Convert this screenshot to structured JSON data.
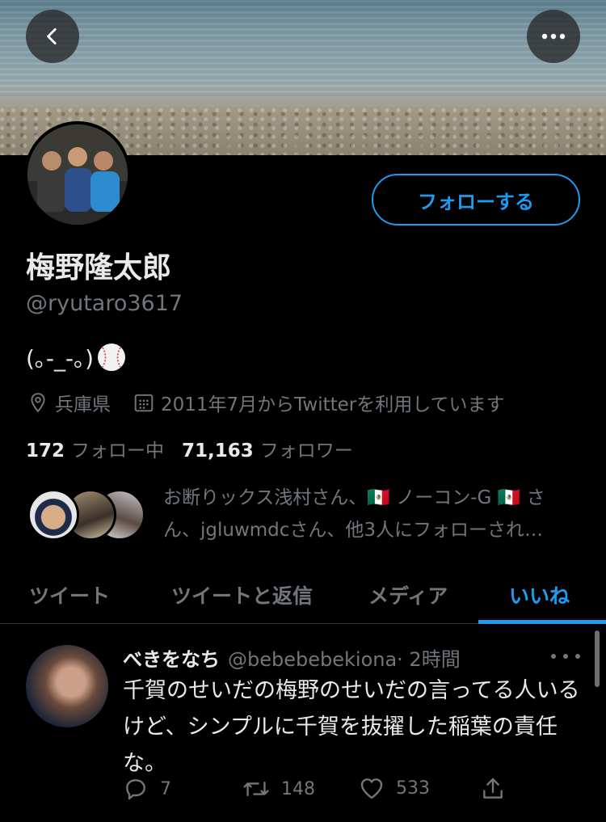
{
  "profile": {
    "name": "梅野隆太郎",
    "handle": "@ryutaro3617",
    "bio": "(｡-_-｡)",
    "location": "兵庫県",
    "joined": "2011年7月からTwitterを利用しています",
    "following_count": "172",
    "following_label": "フォロー中",
    "followers_count": "71,163",
    "followers_label": "フォロワー",
    "follow_button": "フォローする",
    "followed_by_line1": "お断りックス浅村さん、🇲🇽 ノーコン-G 🇲🇽 さ",
    "followed_by_line2": "ん、jgluwmdcさん、他3人にフォローされ…"
  },
  "tabs": [
    {
      "label": "ツイート",
      "active": false
    },
    {
      "label": "ツイートと返信",
      "active": false
    },
    {
      "label": "メディア",
      "active": false
    },
    {
      "label": "いいね",
      "active": true
    }
  ],
  "tweet": {
    "name": "べきをなち",
    "handle": "@bebebebekiona",
    "time": "· 2時間",
    "body": "千賀のせいだの梅野のせいだの言ってる人いるけど、シンプルに千賀を抜擢した稲葉の責任な。",
    "replies": "7",
    "retweets": "148",
    "likes": "533"
  },
  "icons": [
    "back-arrow-icon",
    "more-dots-icon",
    "location-pin-icon",
    "calendar-icon",
    "baseball-icon",
    "reply-icon",
    "retweet-icon",
    "like-heart-icon",
    "share-icon"
  ],
  "colors": {
    "accent": "#1d9bf0",
    "muted": "#71767b",
    "text": "#e7e9ea",
    "background": "#000000"
  }
}
